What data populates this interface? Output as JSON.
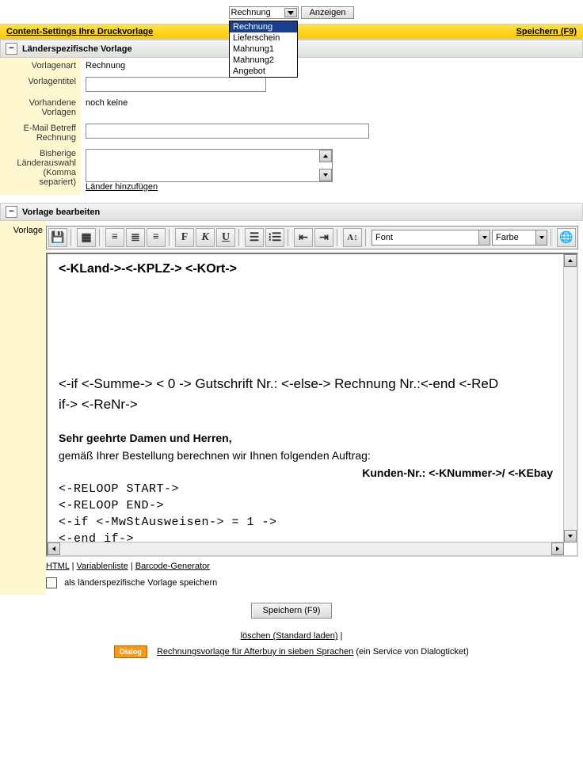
{
  "top": {
    "select_value": "Rechnung",
    "show_btn": "Anzeigen",
    "options": [
      "Rechnung",
      "Lieferschein",
      "Mahnung1",
      "Mahnung2",
      "Angebot"
    ]
  },
  "yellow": {
    "left": "Content-Settings Ihre Druckvorlage",
    "right": "Speichern (F9)"
  },
  "section1": {
    "title": "Länderspezifische Vorlage",
    "collapse_glyph": "−",
    "rows": {
      "vorlagenart_label": "Vorlagenart",
      "vorlagenart_value": "Rechnung",
      "vorlagentitel_label": "Vorlagentitel",
      "vorlagentitel_value": "",
      "vorhandene_label": "Vorhandene Vorlagen",
      "vorhandene_value": "noch keine",
      "email_label": "E-Mail Betreff Rechnung",
      "email_value": "",
      "laender_label": "Bisherige Länderauswahl (Komma separiert)",
      "laender_value": "",
      "laender_link": "Länder hinzufügen"
    }
  },
  "section2": {
    "title": "Vorlage bearbeiten",
    "collapse_glyph": "−",
    "side_label": "Vorlage"
  },
  "toolbar": {
    "font_label": "Font",
    "color_label": "Farbe"
  },
  "editor": {
    "line1": "<-KLand->-<-KPLZ-> <-KOrt->",
    "line2a": "<-if <-Summe-> < 0 -> Gutschrift Nr.: <-else-> Rechnung Nr.:<-end  <-ReD",
    "line2b": "if-> <-ReNr->",
    "salutation": "Sehr geehrte Damen und Herren,",
    "body": "gemäß Ihrer Bestellung berechnen wir Ihnen folgenden Auftrag:",
    "customer": "Kunden-Nr.: <-KNummer->/ <-KEbay",
    "reloop_start": "<-RELOOP START->",
    "reloop_end": "<-RELOOP END->",
    "mwst_if": "<-if <-MwStAusweisen-> = 1 ->",
    "end_if": "<-end if->"
  },
  "below": {
    "html_link": "HTML",
    "varlist_link": "Variablenliste",
    "barcode_link": "Barcode-Generator",
    "checkbox_label": "als länderspezifische Vorlage speichern",
    "save_btn": "Speichern (F9)"
  },
  "footer": {
    "delete_link": "löschen (Standard laden)",
    "sep": " | ",
    "dialog_badge": "Dialog",
    "rv_link": "Rechnungsvorlage für Afterbuy in sieben Sprachen",
    "rv_tail": " (ein Service von Dialogticket)"
  }
}
